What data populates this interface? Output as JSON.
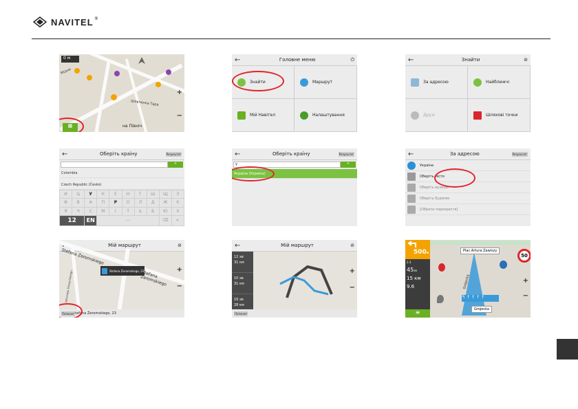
{
  "brand": {
    "name": "NAVITEL",
    "mark": "®"
  },
  "colors": {
    "accent_green": "#6ab023",
    "highlight_red": "#e2232a",
    "nav_orange": "#f3a300"
  },
  "s1": {
    "scale": "0",
    "scale_unit": "м",
    "street1": "Шевченка Тара",
    "street2": "на Північ",
    "street3": "Мідна",
    "menu_icon": "menu-grid-icon"
  },
  "s2": {
    "title": "Головне меню",
    "items": [
      "Знайти",
      "Маршрут",
      "Мій Навітел",
      "Налаштування"
    ]
  },
  "s3": {
    "title": "Знайти",
    "items": [
      "За адресою",
      "Найближчі",
      "Друзі",
      "Шляхові точки"
    ]
  },
  "s4": {
    "title": "Оберіть країну",
    "results_btn": "Результат",
    "rows": [
      "Colombia",
      "Czech Republic (Česko)"
    ],
    "keys": [
      "И",
      "Ц",
      "У",
      "К",
      "Е",
      "Н",
      "Г",
      "Ш",
      "Щ",
      "З",
      "Ф",
      "В",
      "А",
      "П",
      "Р",
      "О",
      "Л",
      "Д",
      "Ж",
      "Є",
      "Я",
      "Ч",
      "С",
      "М",
      "І",
      "Т",
      "Ь",
      "Б",
      "Ю",
      "Х"
    ],
    "key_num": "12",
    "key_lang": "EN"
  },
  "s5": {
    "title": "Оберіть країну",
    "results_btn": "Результат",
    "input": "у",
    "highlight": "Україна (Україна)"
  },
  "s6": {
    "title": "За адресою",
    "results_btn": "Результат",
    "rows": [
      "Україна",
      "Оберіть місто",
      "Оберіть вулицю",
      "Оберіть будівлю",
      "[Обрати перехрестя]"
    ]
  },
  "s7": {
    "title": "Мій маршрут",
    "street_a": "Stefana Żeromskiego",
    "street_b": "Stefana Żeromskiego",
    "street_c": "Ignacego Daszyńskiego",
    "popup": "Stefana Żeromskiego, 23",
    "bottom_btn": "Поїхали!",
    "bottom_addr": "Stefana Żeromskiego, 23"
  },
  "s8": {
    "title": "Мій маршрут",
    "routes": [
      [
        "12",
        "хв",
        "31 км"
      ],
      [
        "10",
        "хв",
        "31 км"
      ],
      [
        "16",
        "хв",
        "28 км"
      ]
    ],
    "bottom_btn": "Поїхали!"
  },
  "s9": {
    "distance": "500",
    "distance_unit": "м",
    "dist2": "2.3",
    "time": "45",
    "time_unit": "хв",
    "remaining": "15 км",
    "speed": "9.6",
    "speed_limit": "50",
    "street_top": "Plac Artura Zawiszy",
    "street_bottom": "Grojecka",
    "street_side": "Grójecka"
  }
}
